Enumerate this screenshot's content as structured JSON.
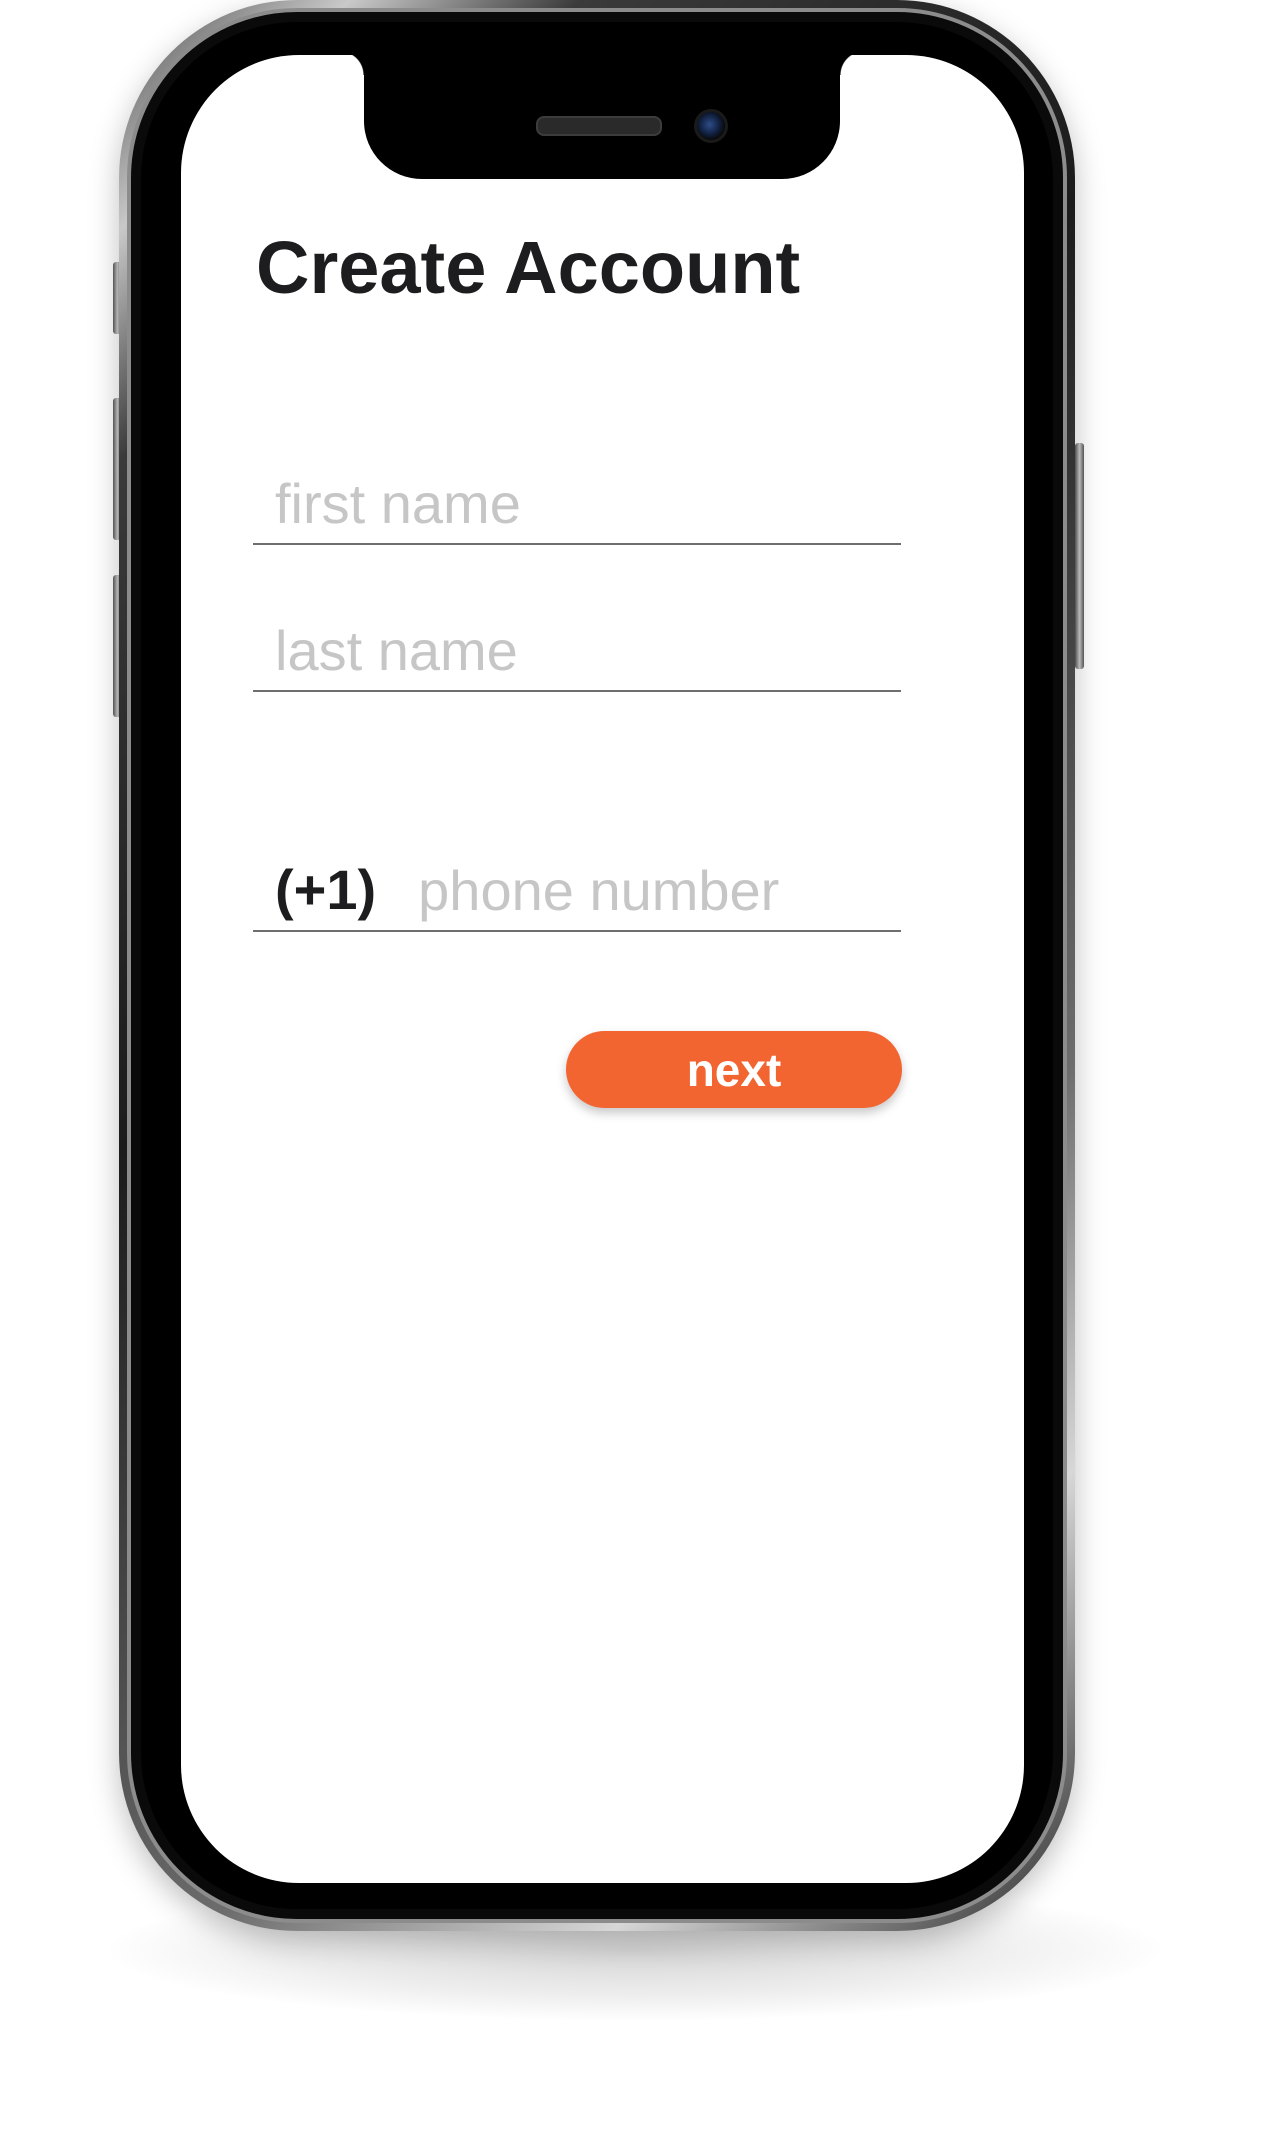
{
  "screen": {
    "title": "Create Account"
  },
  "form": {
    "first_name": {
      "value": "",
      "placeholder": "first name"
    },
    "last_name": {
      "value": "",
      "placeholder": "last name"
    },
    "phone": {
      "country_code": "(+1)",
      "value": "",
      "placeholder": "phone number"
    },
    "next_label": "next"
  },
  "colors": {
    "accent": "#f26531",
    "title_text": "#1d1d1f",
    "placeholder_text": "#c6c6c6",
    "underline": "#6e6e6e",
    "screen_background": "#ffffff",
    "device_frame": "#000000"
  },
  "icons": {
    "camera": "front-camera-icon",
    "speaker": "earpiece-speaker-icon"
  }
}
